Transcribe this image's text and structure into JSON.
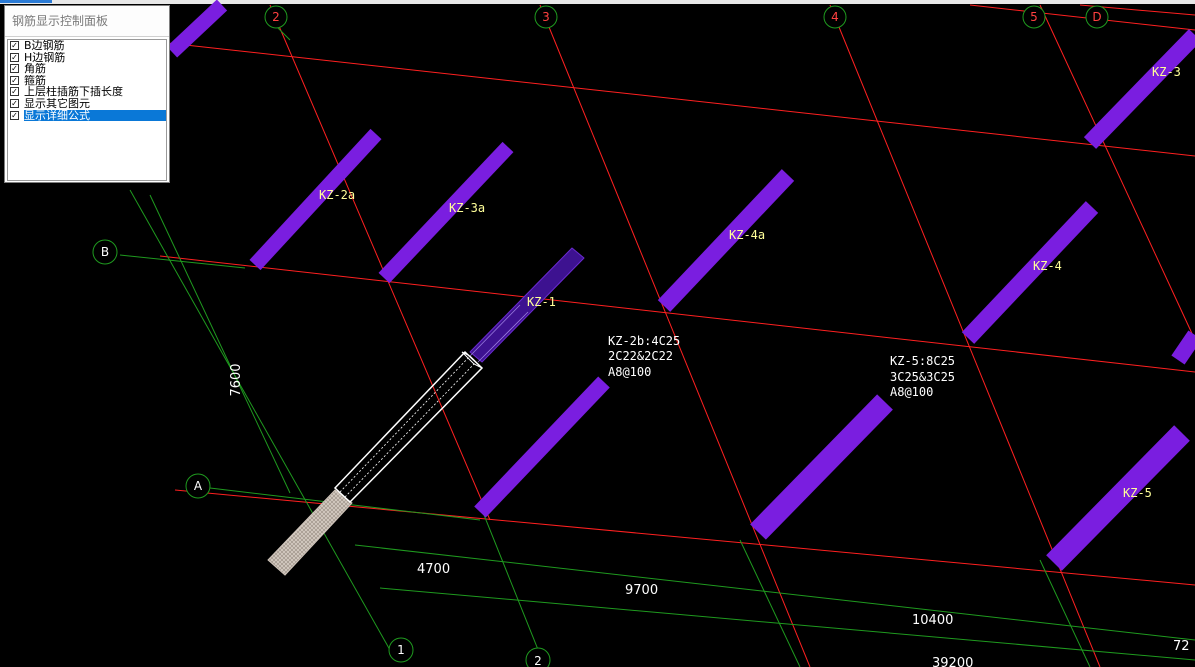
{
  "panel": {
    "title": "钢筋显示控制面板",
    "options": [
      {
        "label": "B边钢筋",
        "checked": true,
        "selected": false
      },
      {
        "label": "H边钢筋",
        "checked": true,
        "selected": false
      },
      {
        "label": "角筋",
        "checked": true,
        "selected": false
      },
      {
        "label": "箍筋",
        "checked": true,
        "selected": false
      },
      {
        "label": "上层柱插筋下插长度",
        "checked": true,
        "selected": false
      },
      {
        "label": "显示其它图元",
        "checked": true,
        "selected": false
      },
      {
        "label": "显示详细公式",
        "checked": true,
        "selected": true
      }
    ]
  },
  "axes": {
    "col_top": [
      "2",
      "3",
      "4",
      "5",
      "D"
    ],
    "col_bottom": [
      "1",
      "2"
    ],
    "rows": [
      "B",
      "A"
    ]
  },
  "columns": {
    "labels": [
      "KZ-2a",
      "KZ-3a",
      "KZ-4a",
      "KZ-4",
      "KZ-3",
      "KZ-1",
      "KZ-5"
    ]
  },
  "annotations": {
    "kz2b": [
      "KZ-2b:4C25",
      "2C22&2C22",
      "A8@100"
    ],
    "kz5": [
      "KZ-5:8C25",
      "3C25&3C25",
      "A8@100"
    ]
  },
  "dimensions": {
    "vertical": "7600",
    "d1": "4700",
    "d2": "9700",
    "d3": "10400",
    "d4": "39200",
    "d5": "72"
  },
  "colors": {
    "background": "#000000",
    "grid_red": "#ff2020",
    "grid_green": "#1f9a1f",
    "column_purple": "#7a1ee0",
    "label_yellow": "#ffff99",
    "selected_rebar": "#c8bdb3"
  }
}
